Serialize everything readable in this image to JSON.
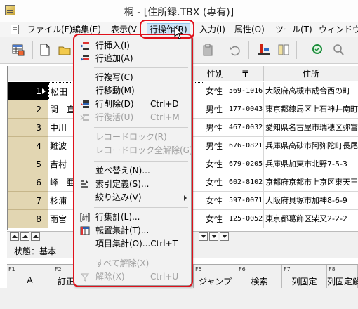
{
  "window": {
    "title": "桐 - [住所録.TBX (専有)]"
  },
  "menubar": {
    "items": [
      {
        "label": "ファイル(F)",
        "active": false
      },
      {
        "label": "編集(E)",
        "active": false
      },
      {
        "label": "表示(V",
        "active": false
      },
      {
        "label": "行操作(R)",
        "active": true
      },
      {
        "label": "入力(I)",
        "active": false
      },
      {
        "label": "属性(O)",
        "active": false
      },
      {
        "label": "ツール(T)",
        "active": false
      },
      {
        "label": "ウィンドウ(W",
        "active": false
      }
    ]
  },
  "grid": {
    "headers": {
      "gender": "性別",
      "zip": "〒",
      "address": "住所"
    },
    "rows": [
      {
        "num": "1",
        "name": "松田",
        "gender": "女性",
        "zip": "569-1016",
        "address": "大阪府高槻市成合西の町",
        "selected": true
      },
      {
        "num": "2",
        "name": "関　直",
        "gender": "男性",
        "zip": "177-0043",
        "address": "東京都練馬区上石神井南町",
        "selected": false
      },
      {
        "num": "3",
        "name": "中川",
        "gender": "男性",
        "zip": "467-0032",
        "address": "愛知県名古屋市瑞穂区弥富",
        "selected": false
      },
      {
        "num": "4",
        "name": "難波",
        "gender": "男性",
        "zip": "676-0821",
        "address": "兵庫県高砂市阿弥陀町長尾",
        "selected": false
      },
      {
        "num": "5",
        "name": "吉村",
        "gender": "女性",
        "zip": "679-0205",
        "address": "兵庫県加東市北野7-5-3",
        "selected": false
      },
      {
        "num": "6",
        "name": "峰　亜",
        "gender": "女性",
        "zip": "602-8102",
        "address": "京都府京都市上京区東天王",
        "selected": false
      },
      {
        "num": "7",
        "name": "杉浦",
        "gender": "女性",
        "zip": "597-0071",
        "address": "大阪府貝塚市加神8-6-9",
        "selected": false
      },
      {
        "num": "8",
        "name": "雨宮",
        "gender": "女性",
        "zip": "125-0052",
        "address": "東京都葛飾区柴又2-2-2",
        "selected": false
      }
    ]
  },
  "dropdown": {
    "items": [
      {
        "label": "行挿入(I)",
        "shortcut": "",
        "disabled": false,
        "icon": "row-insert-icon"
      },
      {
        "label": "行追加(A)",
        "shortcut": "",
        "disabled": false,
        "icon": "row-append-icon"
      },
      {
        "label": "行複写(C)",
        "shortcut": "",
        "disabled": false,
        "icon": ""
      },
      {
        "label": "行移動(M)",
        "shortcut": "",
        "disabled": false,
        "icon": ""
      },
      {
        "label": "行削除(D)",
        "shortcut": "Ctrl+D",
        "disabled": false,
        "icon": "row-delete-icon"
      },
      {
        "label": "行復活(U)",
        "shortcut": "Ctrl+M",
        "disabled": true,
        "icon": "row-restore-icon"
      },
      {
        "label": "レコードロック(R)",
        "shortcut": "",
        "disabled": true,
        "icon": ""
      },
      {
        "label": "レコードロック全解除(G)",
        "shortcut": "",
        "disabled": true,
        "icon": ""
      },
      {
        "label": "並べ替え(N)...",
        "shortcut": "",
        "disabled": false,
        "icon": ""
      },
      {
        "label": "索引定義(S)...",
        "shortcut": "",
        "disabled": false,
        "icon": "index-define-icon"
      },
      {
        "label": "絞り込み(V)",
        "shortcut": "",
        "disabled": false,
        "icon": "",
        "submenu": true
      },
      {
        "label": "行集計(L)...",
        "shortcut": "",
        "disabled": false,
        "icon": "row-aggregate-icon"
      },
      {
        "label": "転置集計(T)...",
        "shortcut": "",
        "disabled": false,
        "icon": "transpose-aggregate-icon"
      },
      {
        "label": "項目集計(O)...Ctrl+T",
        "shortcut": "",
        "disabled": false,
        "icon": ""
      },
      {
        "label": "すべて解除(X)",
        "shortcut": "",
        "disabled": true,
        "icon": ""
      },
      {
        "label": "解除(X)",
        "shortcut": "Ctrl+U",
        "disabled": true,
        "icon": "release-icon"
      }
    ]
  },
  "status": {
    "text": "状態：基本"
  },
  "fkeys": [
    {
      "num": "F1",
      "label": "A"
    },
    {
      "num": "F2",
      "label": "訂正"
    },
    {
      "num": "F5",
      "label": "ジャンプ"
    },
    {
      "num": "F6",
      "label": "検索"
    },
    {
      "num": "F7",
      "label": "列固定"
    },
    {
      "num": "F8",
      "label": "列固定解"
    }
  ],
  "colors": {
    "highlight": "#e0111b",
    "row_header": "#e2d6b2",
    "menu_active": "#cce4f7"
  }
}
